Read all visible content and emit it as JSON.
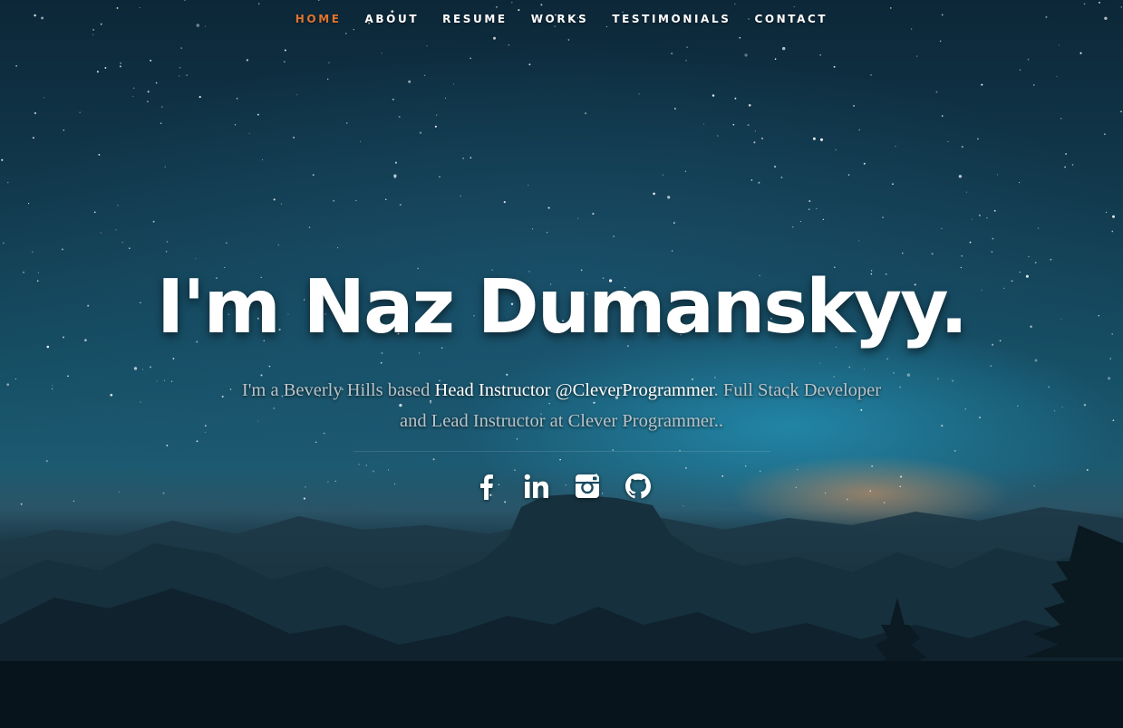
{
  "nav": {
    "items": [
      {
        "label": "HOME",
        "active": true
      },
      {
        "label": "ABOUT",
        "active": false
      },
      {
        "label": "RESUME",
        "active": false
      },
      {
        "label": "WORKS",
        "active": false
      },
      {
        "label": "TESTIMONIALS",
        "active": false
      },
      {
        "label": "CONTACT",
        "active": false
      }
    ]
  },
  "banner": {
    "headline": "I'm Naz Dumanskyy.",
    "intro_before": "I'm a Beverly Hills based ",
    "intro_highlight": "Head Instructor @CleverProgrammer",
    "intro_after": ". Full Stack Developer and Lead Instructor at Clever Programmer.."
  },
  "social": [
    {
      "icon": "facebook-icon"
    },
    {
      "icon": "linkedin-icon"
    },
    {
      "icon": "instagram-icon"
    },
    {
      "icon": "github-icon"
    }
  ],
  "colors": {
    "nav_active": "#e0742f",
    "nav_text": "#ffffff",
    "headline": "#ffffff",
    "intro_text": "#b9c4ca",
    "intro_highlight": "#ffffff"
  }
}
